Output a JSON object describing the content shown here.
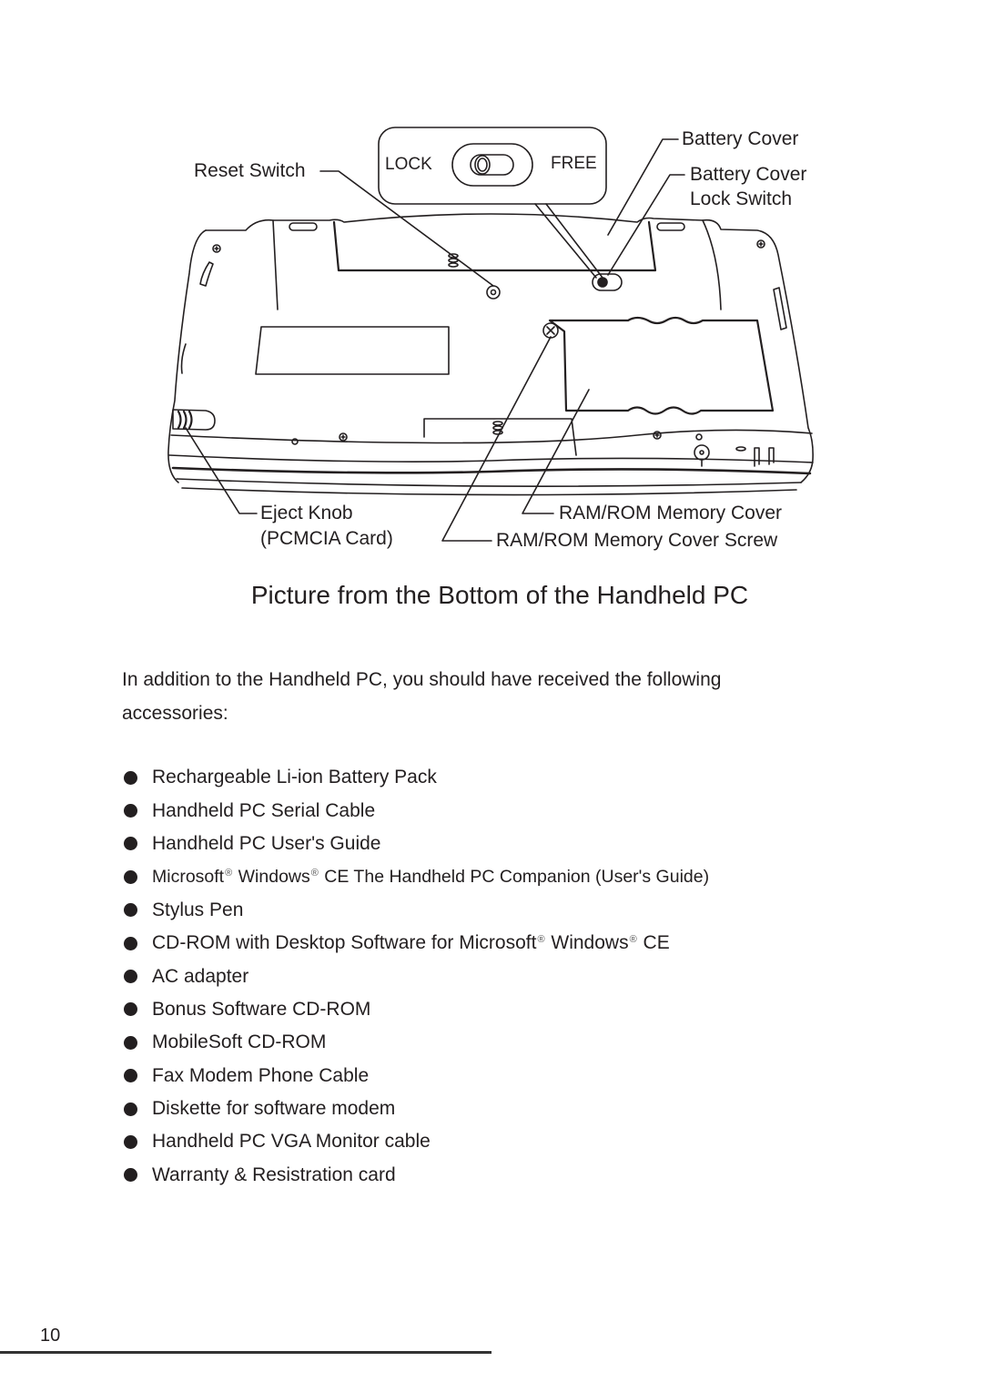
{
  "diagram": {
    "labels": {
      "battery_cover": "Battery Cover",
      "reset_switch": "Reset Switch",
      "battery_cover_lock_switch_line1": "Battery Cover",
      "battery_cover_lock_switch_line2": "Lock Switch",
      "lock": "LOCK",
      "free": "FREE",
      "eject_knob_line1": "Eject Knob",
      "eject_knob_line2": "(PCMCIA Card)",
      "ram_rom_cover": "RAM/ROM Memory Cover",
      "ram_rom_cover_screw": "RAM/ROM Memory Cover Screw"
    },
    "caption": "Picture from the Bottom of the Handheld PC"
  },
  "body": {
    "intro": "In addition to the Handheld PC, you should have received the following accessories:",
    "accessories": [
      {
        "parts": [
          "Rechargeable Li-ion Battery Pack"
        ]
      },
      {
        "parts": [
          "Handheld PC Serial Cable"
        ]
      },
      {
        "parts": [
          "Handheld PC User's Guide"
        ]
      },
      {
        "parts": [
          "Microsoft",
          "®",
          " Windows",
          "®",
          " CE The Handheld PC Companion (User's Guide)"
        ]
      },
      {
        "parts": [
          "Stylus Pen"
        ]
      },
      {
        "parts": [
          "CD-ROM with Desktop Software for Microsoft",
          "®",
          " Windows",
          "®",
          " CE"
        ]
      },
      {
        "parts": [
          "AC adapter"
        ]
      },
      {
        "parts": [
          "Bonus Software CD-ROM"
        ]
      },
      {
        "parts": [
          "MobileSoft CD-ROM"
        ]
      },
      {
        "parts": [
          "Fax Modem Phone Cable"
        ]
      },
      {
        "parts": [
          "Diskette for software modem"
        ]
      },
      {
        "parts": [
          "Handheld PC VGA Monitor cable"
        ]
      },
      {
        "parts": [
          "Warranty & Resistration card"
        ]
      }
    ],
    "bullet_icon": "filled-circle"
  },
  "footer": {
    "page_number": "10"
  }
}
